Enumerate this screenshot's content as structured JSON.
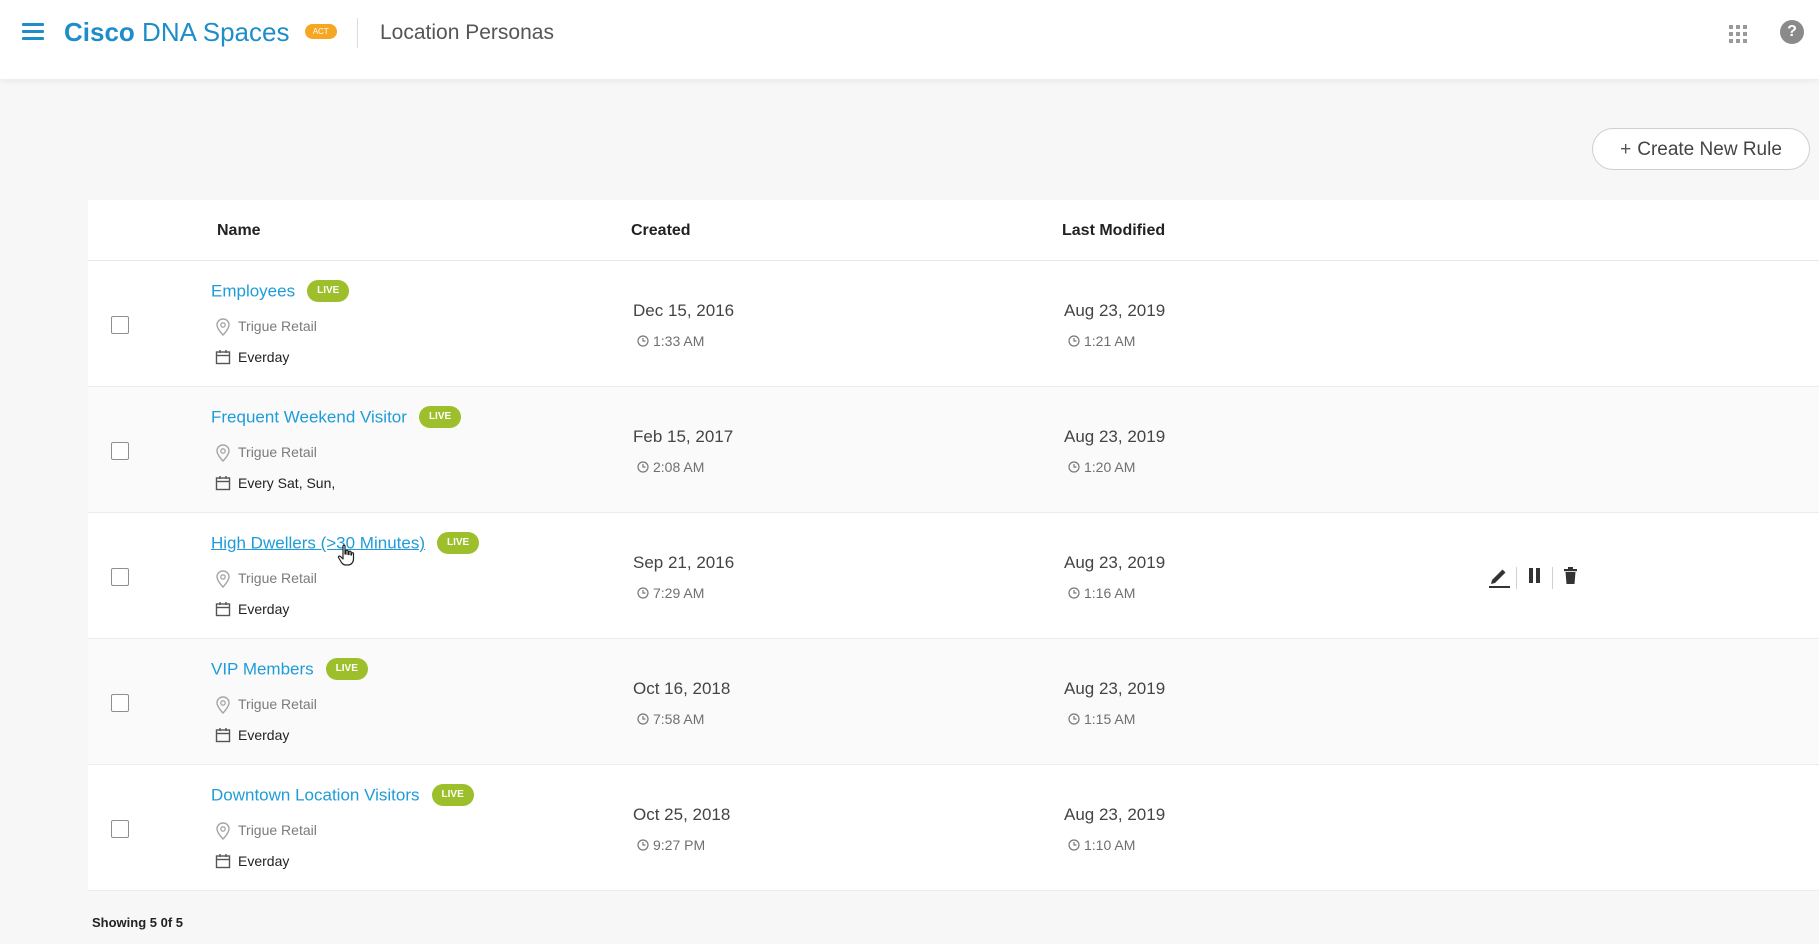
{
  "header": {
    "brand_cisco": "Cisco",
    "brand_product": "DNA Spaces",
    "brand_badge": "ACT",
    "page_title": "Location Personas"
  },
  "toolbar": {
    "create_plus": "+",
    "create_label": "Create New Rule"
  },
  "table": {
    "headers": {
      "name": "Name",
      "created": "Created",
      "last_modified": "Last Modified"
    },
    "rows": [
      {
        "name": "Employees",
        "badge": "LIVE",
        "location": "Trigue Retail",
        "schedule": "Everday",
        "created_date": "Dec 15, 2016",
        "created_time": "1:33 AM",
        "modified_date": "Aug 23, 2019",
        "modified_time": "1:21 AM"
      },
      {
        "name": "Frequent Weekend Visitor",
        "badge": "LIVE",
        "location": "Trigue Retail",
        "schedule": "Every Sat, Sun,",
        "created_date": "Feb 15, 2017",
        "created_time": "2:08 AM",
        "modified_date": "Aug 23, 2019",
        "modified_time": "1:20 AM"
      },
      {
        "name": "High Dwellers (>30 Minutes)",
        "badge": "LIVE",
        "location": "Trigue Retail",
        "schedule": "Everday",
        "created_date": "Sep 21, 2016",
        "created_time": "7:29 AM",
        "modified_date": "Aug 23, 2019",
        "modified_time": "1:16 AM"
      },
      {
        "name": "VIP Members",
        "badge": "LIVE",
        "location": "Trigue Retail",
        "schedule": "Everday",
        "created_date": "Oct 16, 2018",
        "created_time": "7:58 AM",
        "modified_date": "Aug 23, 2019",
        "modified_time": "1:15 AM"
      },
      {
        "name": "Downtown Location Visitors",
        "badge": "LIVE",
        "location": "Trigue Retail",
        "schedule": "Everday",
        "created_date": "Oct 25, 2018",
        "created_time": "9:27 PM",
        "modified_date": "Aug 23, 2019",
        "modified_time": "1:10 AM"
      }
    ]
  },
  "footer": {
    "showing": "Showing 5 0f 5"
  },
  "icons": {
    "menu": "hamburger-menu-icon",
    "apps": "apps-grid-icon",
    "help": "help-icon",
    "location": "map-pin-icon",
    "schedule": "calendar-icon",
    "time": "clock-icon",
    "edit": "edit-pencil-icon",
    "pause": "pause-icon",
    "delete": "trash-icon"
  },
  "colors": {
    "brand_blue": "#1f8dc9",
    "link_blue": "#1f9cd8",
    "live_green": "#9cbf2b",
    "act_orange": "#f5a623"
  }
}
